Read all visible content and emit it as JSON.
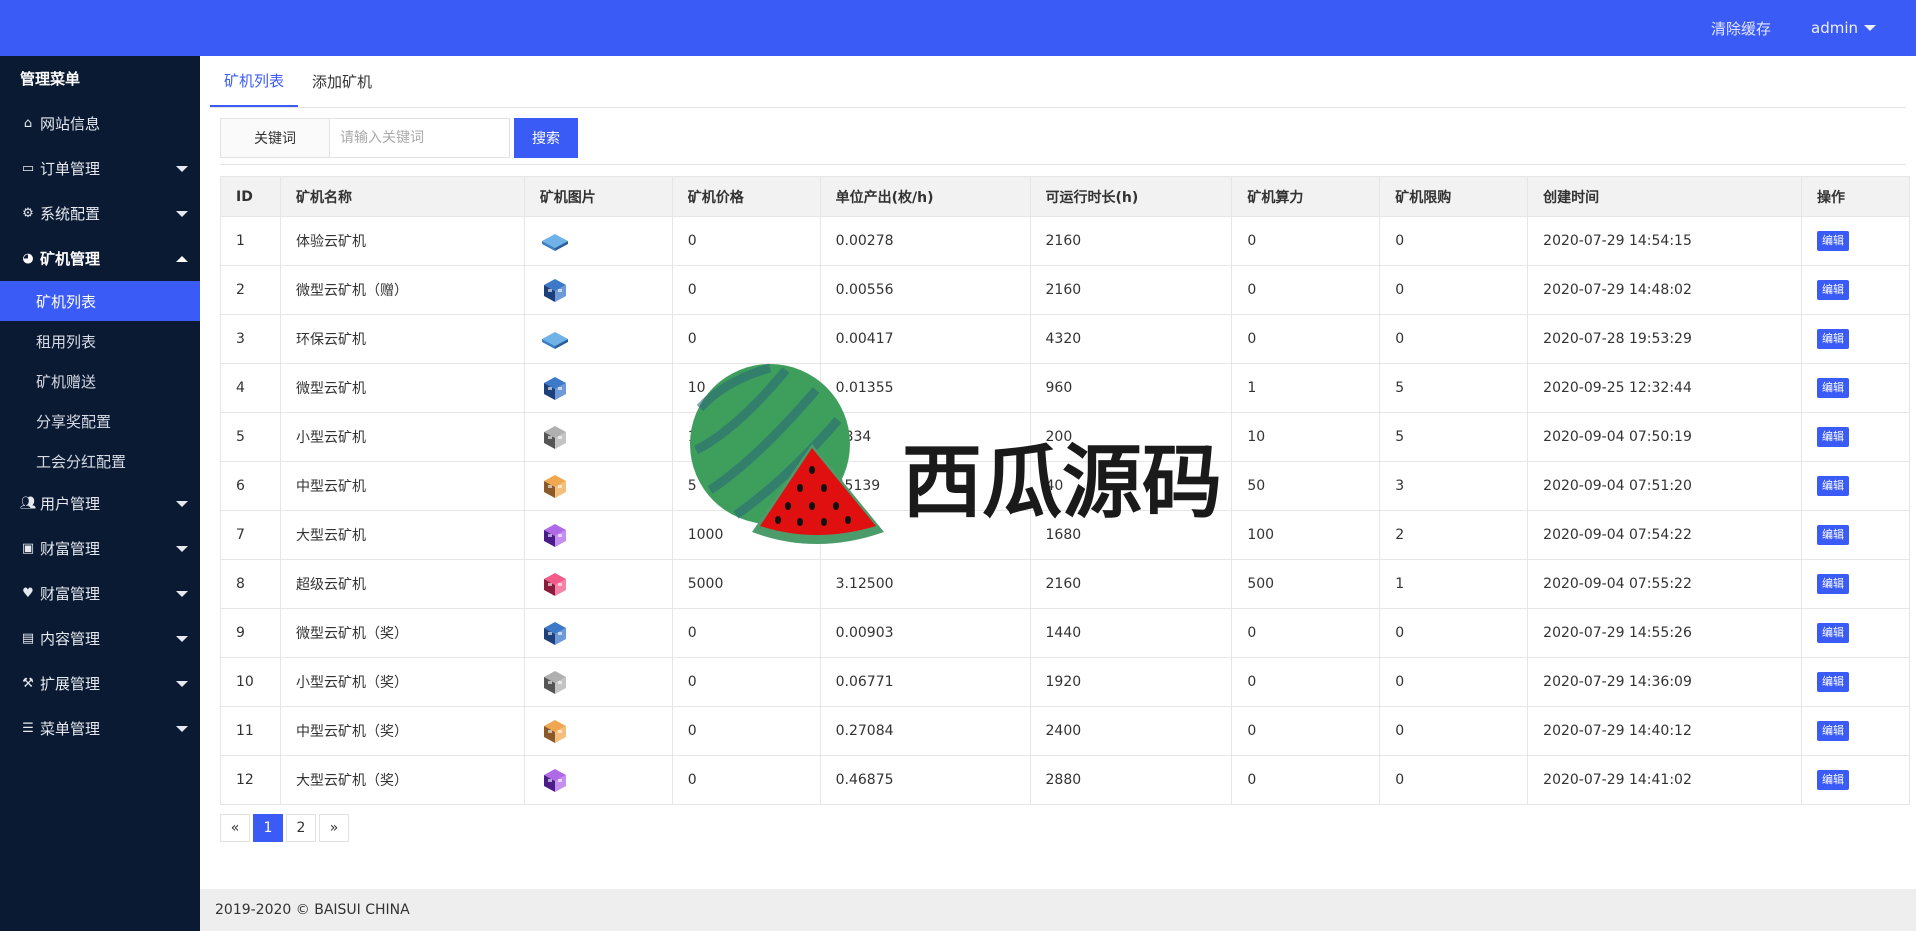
{
  "header": {
    "clear_cache": "清除缓存",
    "user": "admin",
    "bg_color": "#3b5bf7"
  },
  "sidebar": {
    "title": "管理菜单",
    "items": [
      {
        "label": "网站信息",
        "icon": "home-icon"
      },
      {
        "label": "订单管理",
        "icon": "card-icon"
      },
      {
        "label": "系统配置",
        "icon": "cogs-icon"
      },
      {
        "label": "矿机管理",
        "icon": "cube-icon"
      },
      {
        "label": "用户管理",
        "icon": "users-icon"
      },
      {
        "label": "财富管理",
        "icon": "money-icon"
      },
      {
        "label": "财富管理",
        "icon": "heartbeat-icon"
      },
      {
        "label": "内容管理",
        "icon": "file-icon"
      },
      {
        "label": "扩展管理",
        "icon": "wrench-icon"
      },
      {
        "label": "菜单管理",
        "icon": "bars-icon"
      }
    ],
    "subitems": [
      "矿机列表",
      "租用列表",
      "矿机赠送",
      "分享奖配置",
      "工会分红配置"
    ]
  },
  "tabs": [
    "矿机列表",
    "添加矿机"
  ],
  "search": {
    "label": "关键词",
    "placeholder": "请输入关键词",
    "button": "搜索"
  },
  "table": {
    "headers": [
      "ID",
      "矿机名称",
      "矿机图片",
      "矿机价格",
      "单位产出(枚/h)",
      "可运行时长(h)",
      "矿机算力",
      "矿机限购",
      "创建时间",
      "操作"
    ],
    "edit_label": "编辑",
    "rows": [
      {
        "id": "1",
        "name": "体验云矿机",
        "icon": "flat-blue",
        "price": "0",
        "output": "0.00278",
        "hours": "2160",
        "power": "0",
        "limit": "0",
        "created": "2020-07-29 14:54:15"
      },
      {
        "id": "2",
        "name": "微型云矿机（赠）",
        "icon": "blue",
        "price": "0",
        "output": "0.00556",
        "hours": "2160",
        "power": "0",
        "limit": "0",
        "created": "2020-07-29 14:48:02"
      },
      {
        "id": "3",
        "name": "环保云矿机",
        "icon": "flat-blue",
        "price": "0",
        "output": "0.00417",
        "hours": "4320",
        "power": "0",
        "limit": "0",
        "created": "2020-07-28 19:53:29"
      },
      {
        "id": "4",
        "name": "微型云矿机",
        "icon": "blue",
        "price": "10",
        "output": "0.01355",
        "hours": "960",
        "power": "1",
        "limit": "5",
        "created": "2020-09-25 12:32:44"
      },
      {
        "id": "5",
        "name": "小型云矿机",
        "icon": "gray",
        "price": "1",
        "output": "0834",
        "hours": "200",
        "power": "10",
        "limit": "5",
        "created": "2020-09-04 07:50:19"
      },
      {
        "id": "6",
        "name": "中型云矿机",
        "icon": "orange",
        "price": "5",
        "output": "45139",
        "hours": "40",
        "power": "50",
        "limit": "3",
        "created": "2020-09-04 07:51:20"
      },
      {
        "id": "7",
        "name": "大型云矿机",
        "icon": "purple",
        "price": "1000",
        "output": "7",
        "hours": "1680",
        "power": "100",
        "limit": "2",
        "created": "2020-09-04 07:54:22"
      },
      {
        "id": "8",
        "name": "超级云矿机",
        "icon": "pink",
        "price": "5000",
        "output": "3.12500",
        "hours": "2160",
        "power": "500",
        "limit": "1",
        "created": "2020-09-04 07:55:22"
      },
      {
        "id": "9",
        "name": "微型云矿机（奖）",
        "icon": "blue",
        "price": "0",
        "output": "0.00903",
        "hours": "1440",
        "power": "0",
        "limit": "0",
        "created": "2020-07-29 14:55:26"
      },
      {
        "id": "10",
        "name": "小型云矿机（奖）",
        "icon": "gray",
        "price": "0",
        "output": "0.06771",
        "hours": "1920",
        "power": "0",
        "limit": "0",
        "created": "2020-07-29 14:36:09"
      },
      {
        "id": "11",
        "name": "中型云矿机（奖）",
        "icon": "orange",
        "price": "0",
        "output": "0.27084",
        "hours": "2400",
        "power": "0",
        "limit": "0",
        "created": "2020-07-29 14:40:12"
      },
      {
        "id": "12",
        "name": "大型云矿机（奖）",
        "icon": "purple",
        "price": "0",
        "output": "0.46875",
        "hours": "2880",
        "power": "0",
        "limit": "0",
        "created": "2020-07-29 14:41:02"
      }
    ]
  },
  "pagination": {
    "prev": "«",
    "pages": [
      "1",
      "2"
    ],
    "next": "»",
    "current": "1"
  },
  "footer": {
    "text": "2019-2020 © BAISUI CHINA"
  },
  "watermark": {
    "text": "西瓜源码"
  }
}
